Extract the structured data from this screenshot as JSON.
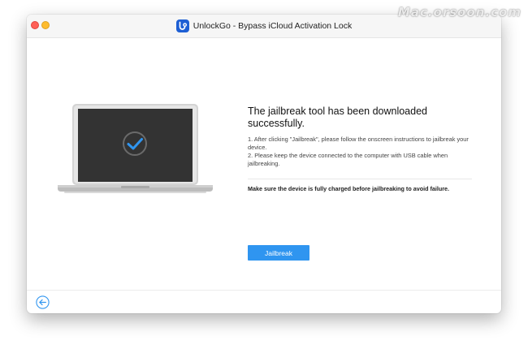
{
  "window": {
    "title": "UnlockGo - Bypass iCloud Activation Lock",
    "app_logo_icon": "unlockgo-logo-icon"
  },
  "watermark": "Mac.orsoon.com",
  "main": {
    "illustration_icon": "laptop-checkmark-icon",
    "headline": "The jailbreak tool has been downloaded successfully.",
    "steps": [
      "1. After clicking \"Jailbreak\", please follow the onscreen instructions to jailbreak your device.",
      "2. Please keep the device connected to the computer with USB cable when jailbreaking."
    ],
    "notice": "Make sure the device is fully charged before jailbreaking to avoid failure.",
    "jailbreak_button": "Jailbreak"
  },
  "footer": {
    "back_icon": "back-arrow-icon"
  },
  "colors": {
    "accent": "#2f95f0",
    "close": "#ff5f57",
    "minimize": "#febc2e",
    "screen": "#333333"
  }
}
